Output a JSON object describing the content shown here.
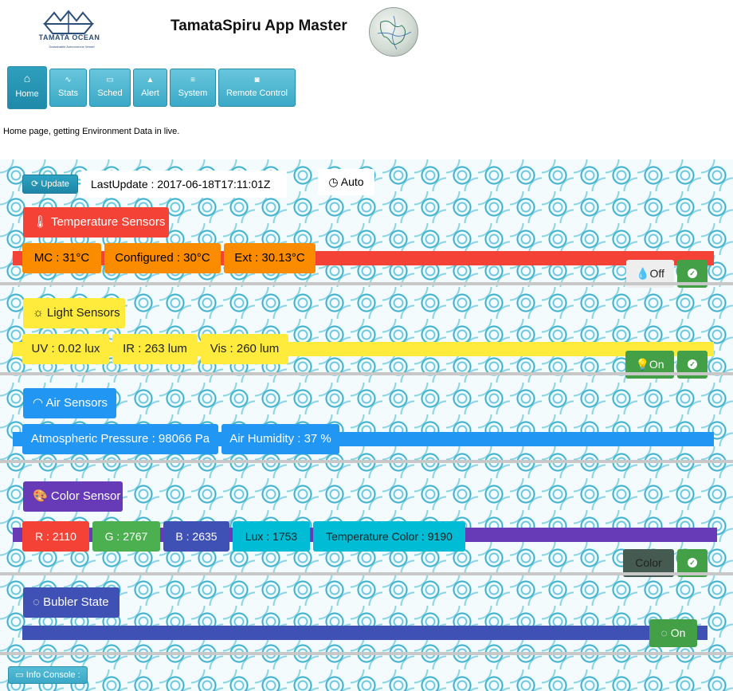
{
  "header": {
    "logo_text": "TAMATA OCEAN",
    "logo_tagline": "Sustainable Autonomous Vessel",
    "title": "TamataSpiru App Master",
    "globe_icon": "globe-map-icon"
  },
  "nav": [
    {
      "label": "Home",
      "icon": "home-icon",
      "active": true
    },
    {
      "label": "Stats",
      "icon": "pulse-icon"
    },
    {
      "label": "Sched",
      "icon": "calendar-icon"
    },
    {
      "label": "Alert",
      "icon": "warning-icon"
    },
    {
      "label": "System",
      "icon": "list-icon"
    },
    {
      "label": "Remote Control",
      "icon": "gamepad-icon"
    }
  ],
  "page_description": "Home page, getting Environment Data in live.",
  "toolbar": {
    "update_label": "Update",
    "last_update": "LastUpdate : 2017-06-18T17:11:01Z",
    "auto_label": "Auto"
  },
  "temperature": {
    "title": "Temperature Sensors",
    "color": "#f44336",
    "chip_color": "#fb8c00",
    "values": [
      "MC : 31°C",
      "Configured : 30°C",
      "Ext : 30.13°C"
    ],
    "toggle_label": "Off",
    "toggle_icon": "drop-icon"
  },
  "light": {
    "title": "Light Sensors",
    "color": "#ffeb3b",
    "values": [
      "UV : 0.02 lux",
      "IR : 263 lum",
      "Vis : 260 lum"
    ],
    "toggle_label": "On",
    "toggle_icon": "bulb-icon"
  },
  "air": {
    "title": "Air Sensors",
    "color": "#2196f3",
    "values": [
      "Atmospheric Pressure : 98066 Pa",
      "Air Humidity : 37 %"
    ]
  },
  "color_sensor": {
    "title": "Color Sensor",
    "color": "#673ab7",
    "values": [
      {
        "text": "R : 2110",
        "color": "#f44336"
      },
      {
        "text": "G : 2767",
        "color": "#4caf50"
      },
      {
        "text": "B : 2635",
        "color": "#3f51b5"
      },
      {
        "text": "Lux : 1753",
        "color": "#00bcd4"
      },
      {
        "text": "Temperature Color : 9190",
        "color": "#00bcd4"
      }
    ],
    "toggle_label": "Color"
  },
  "bubler": {
    "title": "Bubler State",
    "color": "#3f51b5",
    "toggle_label": "On"
  },
  "info_console_label": "Info Console :"
}
